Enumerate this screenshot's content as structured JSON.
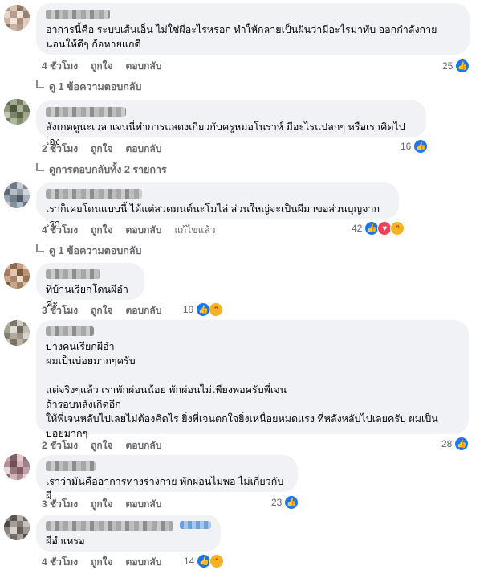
{
  "labels": {
    "like": "ถูกใจ",
    "reply": "ตอบกลับ",
    "edited": "แก้ไขแล้ว"
  },
  "colors": {
    "like": "#1877f2",
    "love": "#f33e58",
    "haha": "#f7b125",
    "meta": "#65676b",
    "bubble": "#f0f2f5"
  },
  "comments": [
    {
      "text": "อาการนี้คือ ระบบเส้นเอ็น ไม่ใช่ผีอะไรหรอก ทำให้กลายเป็นฝันว่ามีอะไรมาทับ ออกกำลังกาย\nนอนให้ดีๆ ก้อหายแกดี",
      "time": "4 ชั่วโมง",
      "reactions": "25",
      "reply_link": "ดู 1 ข้อความตอบกลับ"
    },
    {
      "text": "สังเกตดูนะเวลาเจนนี่ทำการแสดงเกี่ยวกับครูหมอโนราห์ มีอะไรแปลกๆ หรือเราคิดไปเอง",
      "time": "2 ชั่วโมง",
      "reactions": "16",
      "reply_link": "ดูการตอบกลับทั้ง 2 รายการ"
    },
    {
      "text": "เราก็เคยโดนแบบนี้ ได้แต่สวดมนต์นะโมไล่ ส่วนใหญ่จะเป็นผีมาขอส่วนบุญจากเรา",
      "time": "4 ชั่วโมง",
      "reactions": "42",
      "reply_link": "ดู 1 ข้อความตอบกลับ"
    },
    {
      "text": "ที่บ้านเรียกโดนผีอำค่ะ",
      "time": "3 ชั่วโมง",
      "reactions": "19"
    },
    {
      "text": "บางคนเรียกผีอำ\nผมเป็นบ่อยมากๆครับ\n\nแต่จริงๆแล้ว เราพักผ่อนน้อย พักผ่อนไม่เพียงพอครับพี่เจน\nถ้ารอบหลังเกิดอีก\nให้พี่เจนหลับไปเลยไม่ต้องคิดไร ยิ่งพี่เจนตกใจยิ่งเหนื่อยหมดแรง ที่หลังหลับไปเลยครับ ผมเป็น\nบ่อยมากๆ",
      "time": "2 ชั่วโมง",
      "reactions": "28"
    },
    {
      "text": "เราว่ามันคืออาการทางร่างกาย พักผ่อนไม่พอ ไม่เกี่ยวกับผี",
      "time": "3 ชั่วโมง",
      "reactions": "23"
    },
    {
      "text": "ผีอำเหรอ",
      "time": "4 ชั่วโมง",
      "reactions": "14"
    }
  ]
}
